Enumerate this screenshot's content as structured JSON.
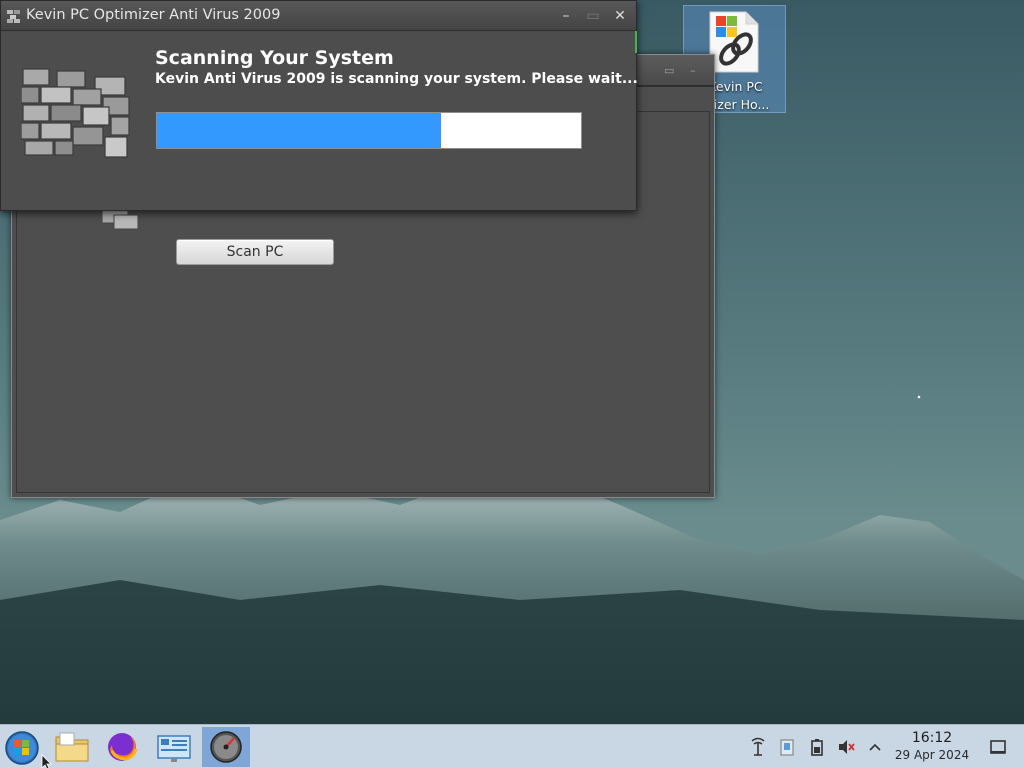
{
  "dialog": {
    "title": "Kevin PC Optimizer Anti Virus 2009",
    "heading": "Scanning Your System",
    "message": "Kevin Anti Virus 2009 is scanning your system. Please wait...",
    "progress_fraction": 0.67,
    "minimize_symbol": "–",
    "maximize_symbol": "▭",
    "close_symbol": "✕"
  },
  "main_window": {
    "scan_button_label": "Scan PC"
  },
  "desktop": {
    "icon_label_line1": "Kevin PC",
    "icon_label_line2": "mizer Ho..."
  },
  "taskbar": {
    "time": "16:12",
    "date": "29 Apr 2024"
  },
  "colors": {
    "progress_fill": "#3399ff",
    "taskbar_bg": "#c9d6e4",
    "window_bg": "#4d4d4d"
  },
  "icons": [
    "start-orb-icon",
    "file-manager-icon",
    "firefox-icon",
    "control-panel-icon",
    "optimizer-app-icon",
    "network-icon",
    "clipboard-icon",
    "battery-icon",
    "volume-muted-icon",
    "tray-expand-icon",
    "show-desktop-icon"
  ]
}
